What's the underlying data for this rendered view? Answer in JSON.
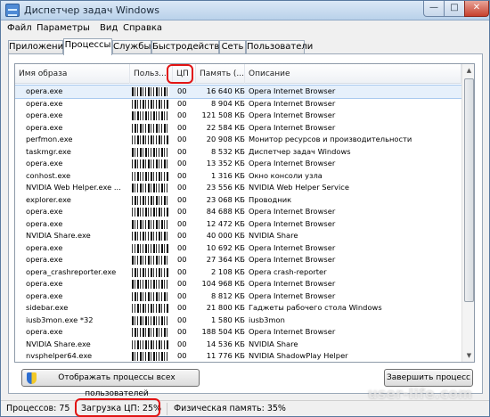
{
  "window": {
    "title": "Диспетчер задач Windows",
    "icon": "task-manager-icon"
  },
  "menu": [
    "Файл",
    "Параметры",
    "Вид",
    "Справка"
  ],
  "tabs": [
    {
      "label": "Приложения",
      "active": false
    },
    {
      "label": "Процессы",
      "active": true
    },
    {
      "label": "Службы",
      "active": false
    },
    {
      "label": "Быстродействие",
      "active": false
    },
    {
      "label": "Сеть",
      "active": false
    },
    {
      "label": "Пользователи",
      "active": false
    }
  ],
  "columns": [
    "Имя образа",
    "Польз...",
    "ЦП",
    "Память (...",
    "Описание"
  ],
  "rows": [
    {
      "name": "opera.exe",
      "cpu": "00",
      "mem": "16 640 КБ",
      "desc": "Opera Internet Browser"
    },
    {
      "name": "opera.exe",
      "cpu": "00",
      "mem": "8 904 КБ",
      "desc": "Opera Internet Browser"
    },
    {
      "name": "opera.exe",
      "cpu": "00",
      "mem": "121 508 КБ",
      "desc": "Opera Internet Browser"
    },
    {
      "name": "opera.exe",
      "cpu": "00",
      "mem": "22 584 КБ",
      "desc": "Opera Internet Browser"
    },
    {
      "name": "perfmon.exe",
      "cpu": "00",
      "mem": "20 908 КБ",
      "desc": "Монитор ресурсов и производительности"
    },
    {
      "name": "taskmgr.exe",
      "cpu": "00",
      "mem": "8 532 КБ",
      "desc": "Диспетчер задач Windows"
    },
    {
      "name": "opera.exe",
      "cpu": "00",
      "mem": "13 352 КБ",
      "desc": "Opera Internet Browser"
    },
    {
      "name": "conhost.exe",
      "cpu": "00",
      "mem": "1 316 КБ",
      "desc": "Окно консоли узла"
    },
    {
      "name": "NVIDIA Web Helper.exe ...",
      "cpu": "00",
      "mem": "23 556 КБ",
      "desc": "NVIDIA Web Helper Service"
    },
    {
      "name": "explorer.exe",
      "cpu": "00",
      "mem": "23 068 КБ",
      "desc": "Проводник"
    },
    {
      "name": "opera.exe",
      "cpu": "00",
      "mem": "84 688 КБ",
      "desc": "Opera Internet Browser"
    },
    {
      "name": "opera.exe",
      "cpu": "00",
      "mem": "12 472 КБ",
      "desc": "Opera Internet Browser"
    },
    {
      "name": "NVIDIA Share.exe",
      "cpu": "00",
      "mem": "40 000 КБ",
      "desc": "NVIDIA Share"
    },
    {
      "name": "opera.exe",
      "cpu": "00",
      "mem": "10 692 КБ",
      "desc": "Opera Internet Browser"
    },
    {
      "name": "opera.exe",
      "cpu": "00",
      "mem": "27 364 КБ",
      "desc": "Opera Internet Browser"
    },
    {
      "name": "opera_crashreporter.exe",
      "cpu": "00",
      "mem": "2 108 КБ",
      "desc": "Opera crash-reporter"
    },
    {
      "name": "opera.exe",
      "cpu": "00",
      "mem": "104 968 КБ",
      "desc": "Opera Internet Browser"
    },
    {
      "name": "opera.exe",
      "cpu": "00",
      "mem": "8 812 КБ",
      "desc": "Opera Internet Browser"
    },
    {
      "name": "sidebar.exe",
      "cpu": "00",
      "mem": "21 800 КБ",
      "desc": "Гаджеты рабочего стола Windows"
    },
    {
      "name": "iusb3mon.exe *32",
      "cpu": "00",
      "mem": "1 580 КБ",
      "desc": "iusb3mon"
    },
    {
      "name": "opera.exe",
      "cpu": "00",
      "mem": "188 504 КБ",
      "desc": "Opera Internet Browser"
    },
    {
      "name": "NVIDIA Share.exe",
      "cpu": "00",
      "mem": "14 536 КБ",
      "desc": "NVIDIA Share"
    },
    {
      "name": "nvsphelper64.exe",
      "cpu": "00",
      "mem": "11 776 КБ",
      "desc": "NVIDIA ShadowPlay Helper"
    }
  ],
  "selected_row": 0,
  "buttons": {
    "show_all": "Отображать процессы всех пользователей",
    "end_process": "Завершить процесс"
  },
  "status": {
    "processes": "Процессов: 75",
    "cpu_load": "Загрузка ЦП: 25%",
    "memory": "Физическая память: 35%"
  },
  "watermark": "user-life.com",
  "colors": {
    "highlight": "#e11414",
    "selection": "#e6f0fb"
  }
}
